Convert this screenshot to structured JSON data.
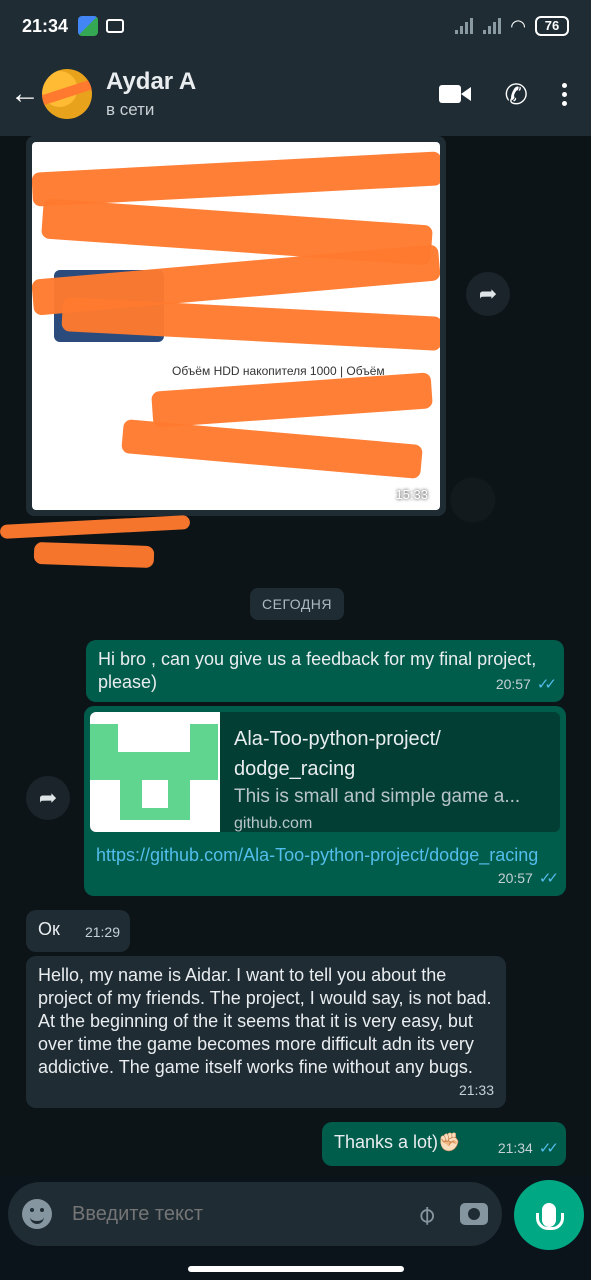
{
  "status_bar": {
    "time": "21:34",
    "battery": "76",
    "wifi_icon": "wifi-icon",
    "signal_icon": "signal-icon"
  },
  "header": {
    "contact_name": "Aydar A",
    "contact_status": "в сети",
    "back_icon": "arrow-left-icon",
    "video_icon": "video-call-icon",
    "phone_icon": "phone-icon",
    "menu_icon": "more-vertical-icon"
  },
  "image_message": {
    "text_fragment": "Объём HDD накопителя 1000 | Объём",
    "time": "15:33"
  },
  "date_divider": "СЕГОДНЯ",
  "messages": [
    {
      "direction": "out",
      "text": "Hi bro , can you give us a feedback for my final project, please)",
      "time": "20:57"
    },
    {
      "direction": "out",
      "preview_title": "Ala-Too-python-project/ dodge_racing",
      "preview_desc": "This is small and simple game a...",
      "preview_domain": "github.com",
      "url": "https://github.com/Ala-Too-python-project/dodge_racing",
      "time": "20:57"
    },
    {
      "direction": "in",
      "text": "Ок",
      "time": "21:29"
    },
    {
      "direction": "in",
      "text": "Hello, my name is Aidar. I want to tell you about the project of my friends. The project, I would say, is not bad. At the beginning of the it seems that it is very easy, but over time the game becomes more difficult adn its very addictive. The game itself works fine without any bugs.",
      "time": "21:33"
    },
    {
      "direction": "out",
      "text": "Thanks a lot)✊🏻",
      "time": "21:34"
    }
  ],
  "composer": {
    "placeholder": "Введите текст"
  },
  "colors": {
    "header_bg": "#1f2c34",
    "outgoing_bubble": "#005c4b",
    "incoming_bubble": "#1f2c34",
    "accent": "#00a884",
    "read_ticks": "#53bdeb",
    "redaction_scribble": "#ff7a2e"
  }
}
